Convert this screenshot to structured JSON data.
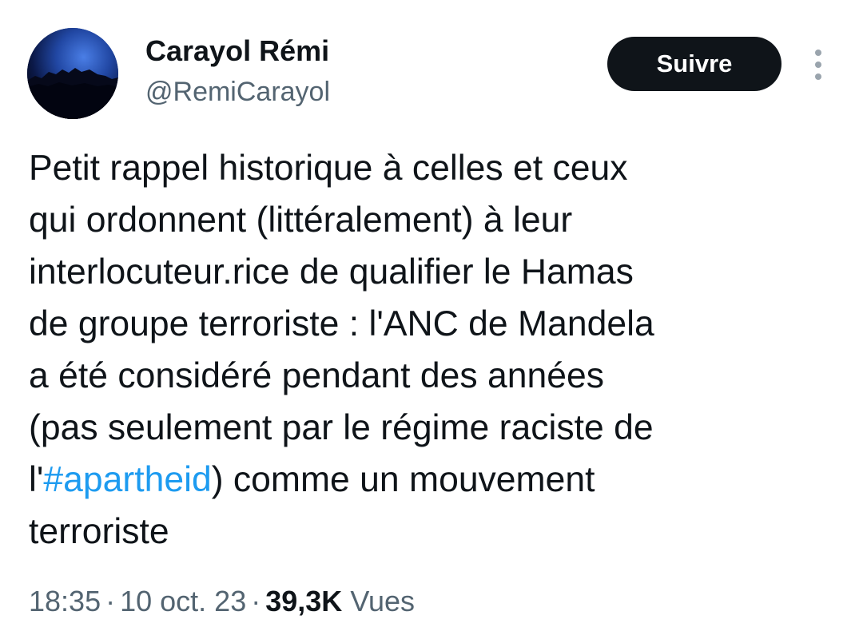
{
  "author": {
    "display_name": "Carayol Rémi",
    "handle": "@RemiCarayol",
    "avatar_icon": "profile-avatar-icon"
  },
  "actions": {
    "follow_label": "Suivre",
    "more_icon": "more-vertical-icon"
  },
  "tweet": {
    "lines": [
      "Petit rappel historique à celles et ceux",
      "qui ordonnent (littéralement) à leur",
      "interlocuteur.rice de qualifier le Hamas",
      "de groupe terroriste : l'ANC de Mandela",
      "a été considéré pendant des années",
      "(pas seulement par le régime raciste de"
    ],
    "hashtag_line": {
      "before": "l'",
      "hashtag": "#apartheid",
      "after": ") comme un mouvement"
    },
    "last_line": "terroriste"
  },
  "meta": {
    "time": "18:35",
    "date": "10 oct. 23",
    "separator": "·",
    "views_count": "39,3K",
    "views_label": "Vues"
  },
  "colors": {
    "text": "#0f1419",
    "secondary_text": "#536471",
    "link": "#1d9bf0",
    "button_bg": "#0f1419",
    "button_text": "#ffffff"
  }
}
